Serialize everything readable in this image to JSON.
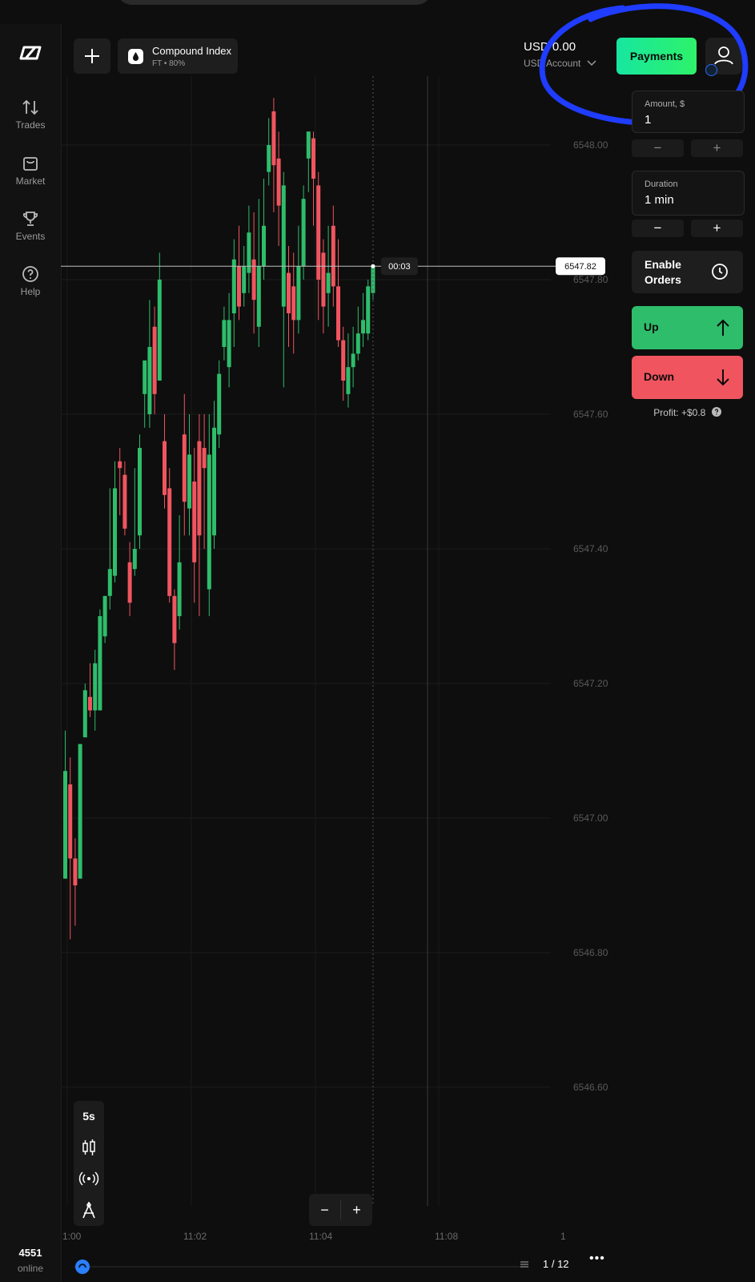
{
  "sidebar": {
    "items": [
      {
        "label": "Trades",
        "icon": "arrows-updown-icon"
      },
      {
        "label": "Market",
        "icon": "bag-icon"
      },
      {
        "label": "Events",
        "icon": "trophy-icon"
      },
      {
        "label": "Help",
        "icon": "question-icon"
      }
    ],
    "online_count": "4551",
    "online_label": "online"
  },
  "header": {
    "asset_name": "Compound Index",
    "asset_sub": "FT • 80%",
    "balance": "USD 0.00",
    "account_label": "USD Account",
    "payments_label": "Payments"
  },
  "panel": {
    "amount_label": "Amount, $",
    "amount_value": "1",
    "duration_label": "Duration",
    "duration_value": "1 min",
    "minus": "−",
    "plus": "+",
    "enable_orders_line1": "Enable",
    "enable_orders_line2": "Orders",
    "up_label": "Up",
    "down_label": "Down",
    "profit_text": "Profit: +$0.8"
  },
  "chart_controls": {
    "timeframe": "5s",
    "zoom_out": "−",
    "zoom_in": "+",
    "page": "1 / 12",
    "more": "•••"
  },
  "colors": {
    "up": "#2ebd6b",
    "down": "#f0555f",
    "accent": "#1fe58e",
    "annotation": "#1f3cff"
  },
  "chart_data": {
    "type": "candlestick",
    "current_price": "6547.82",
    "countdown": "00:03",
    "y_ticks": [
      "6548.00",
      "6547.80",
      "6547.60",
      "6547.40",
      "6547.20",
      "6547.00",
      "6546.80",
      "6546.60"
    ],
    "x_ticks": [
      "1:00",
      "11:02",
      "11:04",
      "11:08",
      "1"
    ],
    "ylim": [
      6546.5,
      6548.1
    ],
    "candles": [
      [
        6546.91,
        6547.07,
        6546.91,
        6547.13
      ],
      [
        6547.05,
        6546.94,
        6546.82,
        6547.09
      ],
      [
        6546.94,
        6546.9,
        6546.84,
        6546.97
      ],
      [
        6546.91,
        6547.11,
        6546.91,
        6547.11
      ],
      [
        6547.12,
        6547.19,
        6547.12,
        6547.2
      ],
      [
        6547.18,
        6547.16,
        6547.15,
        6547.23
      ],
      [
        6547.16,
        6547.23,
        6547.13,
        6547.25
      ],
      [
        6547.16,
        6547.3,
        6547.16,
        6547.31
      ],
      [
        6547.27,
        6547.33,
        6547.26,
        6547.33
      ],
      [
        6547.33,
        6547.37,
        6547.31,
        6547.49
      ],
      [
        6547.36,
        6547.49,
        6547.35,
        6547.53
      ],
      [
        6547.53,
        6547.52,
        6547.45,
        6547.55
      ],
      [
        6547.51,
        6547.43,
        6547.42,
        6547.53
      ],
      [
        6547.38,
        6547.32,
        6547.3,
        6547.41
      ],
      [
        6547.37,
        6547.4,
        6547.36,
        6547.52
      ],
      [
        6547.42,
        6547.55,
        6547.4,
        6547.57
      ],
      [
        6547.63,
        6547.68,
        6547.58,
        6547.64
      ],
      [
        6547.6,
        6547.7,
        6547.58,
        6547.77
      ],
      [
        6547.73,
        6547.63,
        6547.6,
        6547.76
      ],
      [
        6547.65,
        6547.8,
        6547.65,
        6547.84
      ],
      [
        6547.56,
        6547.48,
        6547.46,
        6547.6
      ],
      [
        6547.49,
        6547.33,
        6547.32,
        6547.52
      ],
      [
        6547.33,
        6547.26,
        6547.22,
        6547.34
      ],
      [
        6547.3,
        6547.38,
        6547.28,
        6547.45
      ],
      [
        6547.57,
        6547.47,
        6547.42,
        6547.63
      ],
      [
        6547.46,
        6547.54,
        6547.42,
        6547.6
      ],
      [
        6547.5,
        6547.38,
        6547.32,
        6547.55
      ],
      [
        6547.56,
        6547.42,
        6547.3,
        6547.6
      ],
      [
        6547.55,
        6547.52,
        6547.4,
        6547.6
      ],
      [
        6547.34,
        6547.54,
        6547.3,
        6547.6
      ],
      [
        6547.42,
        6547.58,
        6547.4,
        6547.62
      ],
      [
        6547.57,
        6547.66,
        6547.55,
        6547.68
      ],
      [
        6547.7,
        6547.74,
        6547.68,
        6547.76
      ],
      [
        6547.67,
        6547.74,
        6547.64,
        6547.78
      ],
      [
        6547.75,
        6547.83,
        6547.7,
        6547.86
      ],
      [
        6547.82,
        6547.76,
        6547.74,
        6547.88
      ],
      [
        6547.78,
        6547.82,
        6547.76,
        6547.85
      ],
      [
        6547.81,
        6547.87,
        6547.78,
        6547.91
      ],
      [
        6547.83,
        6547.77,
        6547.72,
        6547.9
      ],
      [
        6547.73,
        6547.82,
        6547.7,
        6547.92
      ],
      [
        6547.82,
        6547.88,
        6547.8,
        6547.95
      ],
      [
        6547.96,
        6548.0,
        6547.94,
        6548.04
      ],
      [
        6548.05,
        6547.97,
        6547.9,
        6548.07
      ],
      [
        6547.98,
        6547.91,
        6547.85,
        6548.02
      ],
      [
        6547.76,
        6547.94,
        6547.64,
        6547.96
      ],
      [
        6547.81,
        6547.75,
        6547.7,
        6547.85
      ],
      [
        6547.79,
        6547.74,
        6547.69,
        6547.84
      ],
      [
        6547.74,
        6547.82,
        6547.72,
        6547.88
      ],
      [
        6547.82,
        6547.92,
        6547.8,
        6547.94
      ],
      [
        6547.98,
        6548.02,
        6547.93,
        6548.02
      ],
      [
        6548.01,
        6547.95,
        6547.88,
        6548.02
      ],
      [
        6547.94,
        6547.8,
        6547.74,
        6547.96
      ],
      [
        6547.84,
        6547.76,
        6547.72,
        6547.86
      ],
      [
        6547.78,
        6547.81,
        6547.73,
        6547.88
      ],
      [
        6547.88,
        6547.79,
        6547.76,
        6547.91
      ],
      [
        6547.79,
        6547.71,
        6547.7,
        6547.86
      ],
      [
        6547.71,
        6547.65,
        6547.62,
        6547.73
      ],
      [
        6547.63,
        6547.67,
        6547.61,
        6547.72
      ],
      [
        6547.67,
        6547.69,
        6547.64,
        6547.73
      ],
      [
        6547.69,
        6547.72,
        6547.68,
        6547.76
      ],
      [
        6547.72,
        6547.74,
        6547.7,
        6547.78
      ],
      [
        6547.72,
        6547.79,
        6547.71,
        6547.8
      ],
      [
        6547.78,
        6547.82,
        6547.77,
        6547.82
      ]
    ]
  }
}
